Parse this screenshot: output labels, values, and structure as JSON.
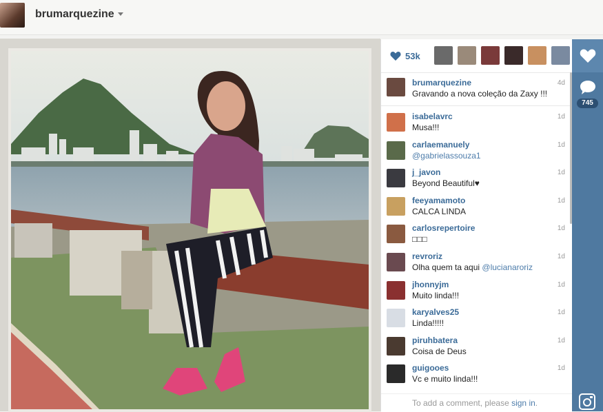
{
  "header": {
    "username": "brumarquezine"
  },
  "post": {
    "likes": "53k",
    "caption": {
      "user": "brumarquezine",
      "text": "Gravando a nova coleção da Zaxy !!!",
      "time": "4d"
    },
    "comments": [
      {
        "user": "isabelavrc",
        "text": "Musa!!!",
        "time": "1d",
        "color": "#d0704a"
      },
      {
        "user": "carlaemanuely",
        "text": "@gabrielassouza1",
        "mention": true,
        "time": "1d",
        "color": "#5a6a4a"
      },
      {
        "user": "j_javon",
        "text": "Beyond Beautiful♥",
        "time": "1d",
        "color": "#3a3a40"
      },
      {
        "user": "feeyamamoto",
        "text": "CALCA LINDA",
        "time": "1d",
        "color": "#c8a060"
      },
      {
        "user": "carlosrepertoire",
        "text": "□□□",
        "time": "1d",
        "color": "#8a5a40"
      },
      {
        "user": "revroriz",
        "text": "Olha quem ta aqui ",
        "mention_text": "@lucianaroriz",
        "time": "1d",
        "color": "#6a4a50"
      },
      {
        "user": "jhonnyjm",
        "text": "Muito linda!!!",
        "time": "1d",
        "color": "#8a3030"
      },
      {
        "user": "karyalves25",
        "text": "Linda!!!!!",
        "time": "1d",
        "color": "#d8dde4"
      },
      {
        "user": "piruhbatera",
        "text": "Coisa de Deus",
        "time": "1d",
        "color": "#4a3a30"
      },
      {
        "user": "guigooes",
        "text": "Vc e muito linda!!!",
        "time": "1d",
        "color": "#2a2a2a"
      }
    ],
    "add_comment": {
      "prefix": "To add a comment, please ",
      "link": "sign in",
      "suffix": "."
    },
    "likers_colors": [
      "#6a6a6a",
      "#9a8a7a",
      "#7a3a3a",
      "#3a2a2a",
      "#c89060",
      "#7a8aa0"
    ]
  },
  "sidebar": {
    "comment_count": "745"
  },
  "colors": {
    "accent": "#3b6b98",
    "sidebar": "#4f79a0"
  }
}
